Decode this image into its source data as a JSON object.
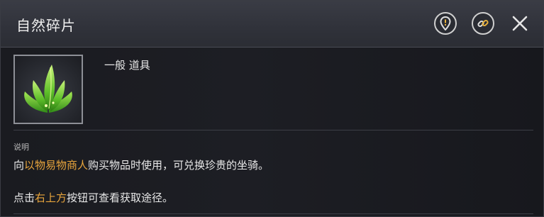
{
  "header": {
    "title": "自然碎片"
  },
  "item": {
    "category": "一般 道具"
  },
  "description": {
    "label": "说明",
    "line1": {
      "pre": "向",
      "highlight": "以物易物商人",
      "post": "购买物品时使用，可兑换珍贵的坐骑。"
    },
    "line2": {
      "pre": "点击",
      "highlight": "右上方",
      "post": "按钮可查看获取途径。"
    }
  },
  "colors": {
    "highlight": "#e8a53c",
    "text": "#e8e8e8",
    "header_bg": "#30323a"
  },
  "icons": {
    "location": "location-pin-icon",
    "link": "chain-link-icon",
    "close": "close-icon",
    "item": "green-leaf-sprout-icon"
  }
}
